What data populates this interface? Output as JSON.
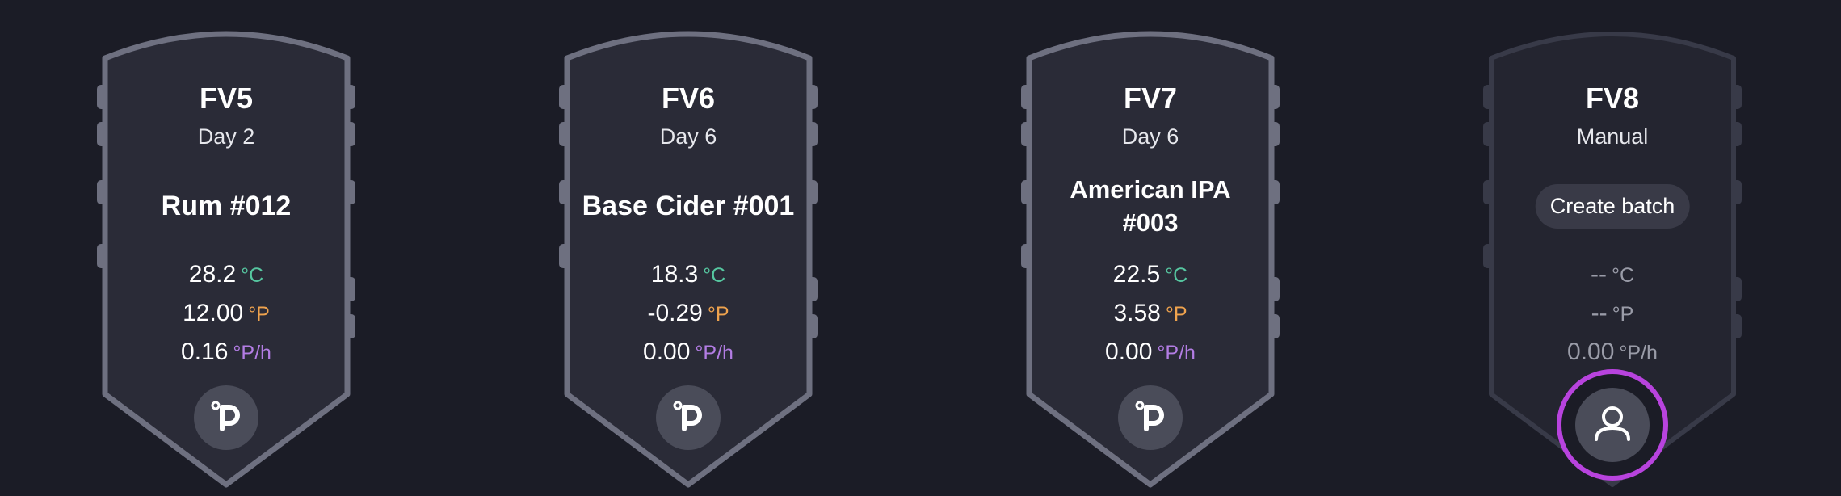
{
  "fermenters": [
    {
      "name": "FV5",
      "day": "Day 2",
      "batch": "Rum #012",
      "temp": "28.2",
      "temp_unit": "°C",
      "gravity": "12.00",
      "gravity_unit": "°P",
      "rate": "0.16",
      "rate_unit": "°P/h",
      "icon": "plaato-logo-icon"
    },
    {
      "name": "FV6",
      "day": "Day 6",
      "batch": "Base Cider #001",
      "temp": "18.3",
      "temp_unit": "°C",
      "gravity": "-0.29",
      "gravity_unit": "°P",
      "rate": "0.00",
      "rate_unit": "°P/h",
      "icon": "plaato-logo-icon"
    },
    {
      "name": "FV7",
      "day": "Day 6",
      "batch_line1": "American IPA",
      "batch_line2": "#003",
      "temp": "22.5",
      "temp_unit": "°C",
      "gravity": "3.58",
      "gravity_unit": "°P",
      "rate": "0.00",
      "rate_unit": "°P/h",
      "icon": "plaato-logo-icon"
    },
    {
      "name": "FV8",
      "day": "Manual",
      "create_batch": "Create batch",
      "temp": "--",
      "temp_unit": "°C",
      "gravity": "--",
      "gravity_unit": "°P",
      "rate": "0.00",
      "rate_unit": "°P/h",
      "icon": "user-icon"
    }
  ],
  "colors": {
    "background": "#1b1c26",
    "tank_fill": "#2a2b37",
    "tank_outline": "#6e7080",
    "tank_outline_inactive": "#383a48",
    "temp_unit": "#56c6a0",
    "gravity_unit": "#efa34e",
    "rate_unit": "#b37de4",
    "highlight_ring": "#b843de"
  }
}
